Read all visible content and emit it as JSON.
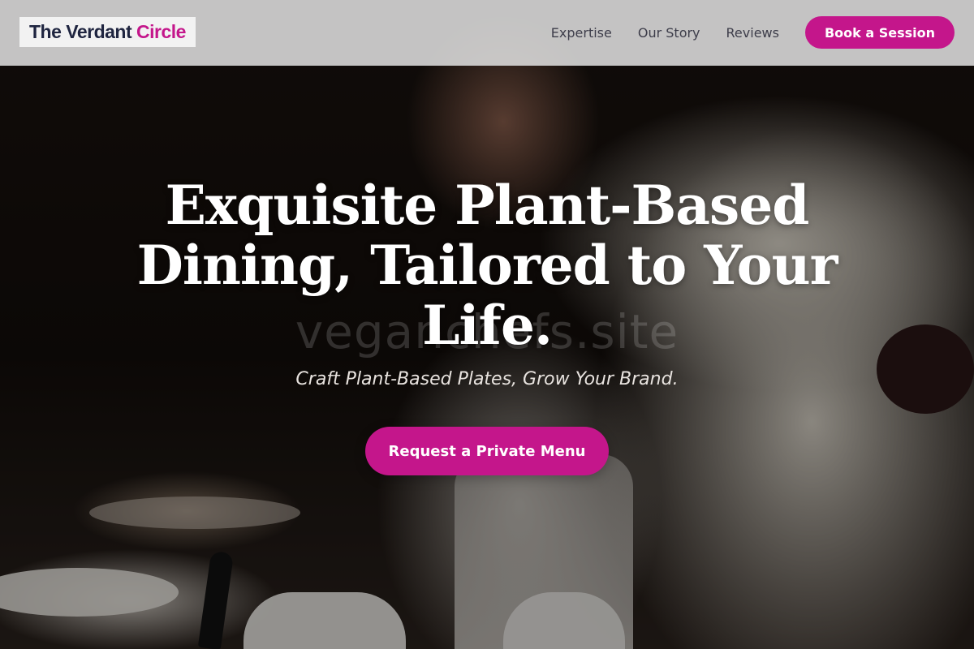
{
  "brand": {
    "name_part1": "The Verdant",
    "name_part2": "Circle",
    "primary_color": "#c4168b",
    "dark_color": "#1f2540"
  },
  "nav": {
    "items": [
      "Expertise",
      "Our Story",
      "Reviews"
    ],
    "cta_label": "Book a Session"
  },
  "hero": {
    "title": "Exquisite Plant-Based Dining, Tailored to Your Life.",
    "subtitle": "Craft Plant-Based Plates, Grow Your Brand.",
    "cta_label": "Request a Private Menu",
    "watermark": "veganchefs.site",
    "background_image": "chef-plating-dish-photo"
  }
}
